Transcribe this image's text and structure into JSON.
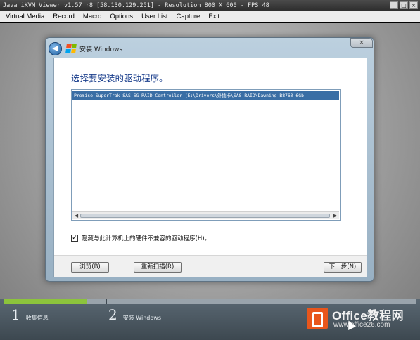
{
  "kvm": {
    "title": "Java iKVM Viewer v1.57 r8 [58.130.129.251] - Resolution 800 X 600 - FPS 48",
    "window_buttons": [
      "_",
      "□",
      "×"
    ],
    "menu": [
      "Virtual Media",
      "Record",
      "Macro",
      "Options",
      "User List",
      "Capture",
      "Exit"
    ]
  },
  "dialog": {
    "title": "安装 Windows",
    "close_glyph": "×",
    "instruction": "选择要安装的驱动程序。",
    "drivers": [
      "Promise SuperTrak SAS 6G RAID Controller (E:\\Drivers\\外插卡\\SAS RAID\\Dawning B8760 6Gb"
    ],
    "hide_incompatible": {
      "checked": true,
      "label": "隐藏与此计算机上的硬件不兼容的驱动程序(H)。"
    },
    "buttons": {
      "browse": "浏览(B)",
      "rescan": "重新扫描(R)",
      "next": "下一步(N)"
    }
  },
  "setup_progress": {
    "fraction_complete": 0.2,
    "steps": [
      {
        "number": "1",
        "label": "收集信息"
      },
      {
        "number": "2",
        "label": "安装 Windows"
      }
    ]
  },
  "watermark": {
    "name": "Office教程网",
    "url": "www.office26.com"
  },
  "colors": {
    "accent_blue": "#1a3e8c",
    "selection": "#3a6ea5",
    "progress": "#8cc43c",
    "watermark_orange": "#e8561c"
  }
}
